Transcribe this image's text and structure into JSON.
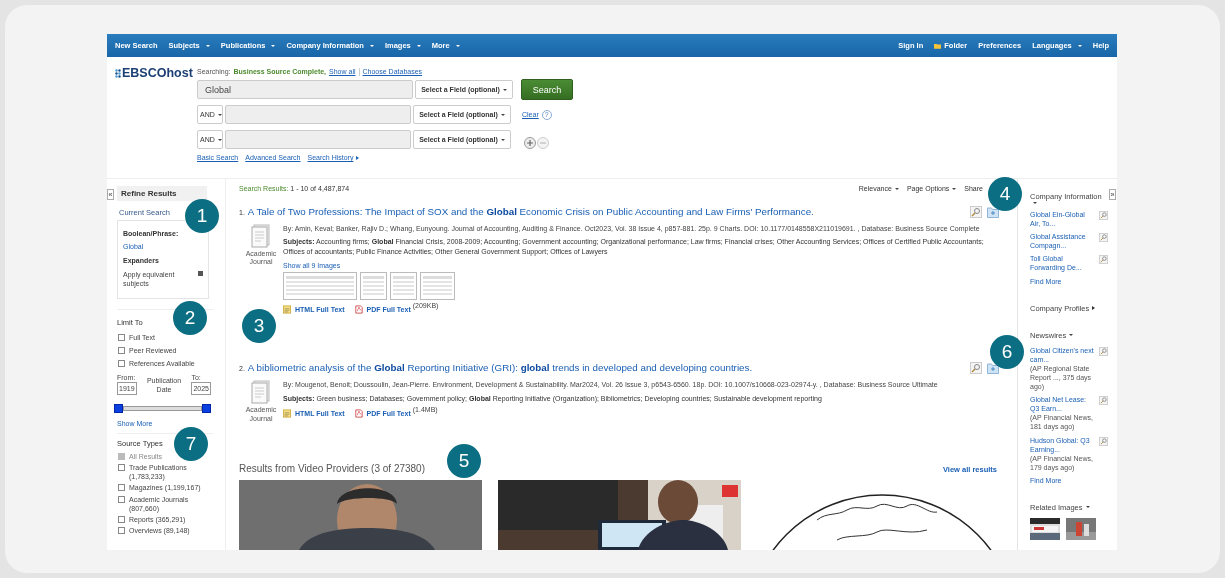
{
  "nav": {
    "left": [
      {
        "label": "New Search",
        "dropdown": false
      },
      {
        "label": "Subjects",
        "dropdown": true
      },
      {
        "label": "Publications",
        "dropdown": true
      },
      {
        "label": "Company Information",
        "dropdown": true
      },
      {
        "label": "Images",
        "dropdown": true
      },
      {
        "label": "More",
        "dropdown": true
      }
    ],
    "right": [
      {
        "label": "Sign In",
        "kind": "text"
      },
      {
        "label": "Folder",
        "kind": "folder"
      },
      {
        "label": "Preferences",
        "kind": "text"
      },
      {
        "label": "Languages",
        "kind": "dropdown"
      },
      {
        "label": "Help",
        "kind": "text"
      }
    ]
  },
  "search": {
    "logo": "EBSCOhost",
    "searching_label": "Searching:",
    "database": "Business Source Complete,",
    "show_all": "Show all",
    "choose_databases": "Choose Databases",
    "rows": [
      {
        "value": "Global",
        "field": "Select a Field (optional)"
      },
      {
        "operator": "AND",
        "field": "Select a Field (optional)"
      },
      {
        "operator": "AND",
        "field": "Select a Field (optional)"
      }
    ],
    "button": "Search",
    "clear": "Clear",
    "help": "?",
    "links": [
      {
        "label": "Basic Search",
        "kind": "link"
      },
      {
        "label": "Advanced Search",
        "kind": "link"
      },
      {
        "label": "Search History",
        "kind": "menu"
      }
    ]
  },
  "refine": {
    "collapse": "«",
    "title": "Refine Results",
    "current": {
      "title": "Current Search",
      "groups": [
        {
          "heading": "Boolean/Phrase:",
          "items": [
            {
              "kind": "link",
              "text": "Global"
            }
          ]
        },
        {
          "heading": "Expanders",
          "items": [
            {
              "kind": "removable",
              "text": "Apply equivalent subjects"
            }
          ]
        }
      ]
    },
    "limit": {
      "title": "Limit To",
      "options": [
        {
          "label": "Full Text",
          "checked": false
        },
        {
          "label": "Peer Reviewed",
          "checked": false
        },
        {
          "label": "References Available",
          "checked": false
        }
      ]
    },
    "date": {
      "from_label": "From:",
      "from": "1919",
      "label": "Publication Date",
      "to_label": "To:",
      "to": "2025",
      "level": 1
    },
    "show_more": "Show More",
    "source": {
      "title": "Source Types",
      "options": [
        {
          "label": "All Results",
          "checked": true,
          "disabled": true
        },
        {
          "label": "Trade Publications (1,783,233)",
          "checked": false,
          "disabled": false
        },
        {
          "label": "Magazines (1,199,167)",
          "checked": false,
          "disabled": false
        },
        {
          "label": "Academic Journals (807,660)",
          "checked": false,
          "disabled": false
        },
        {
          "label": "Reports (365,291)",
          "checked": false,
          "disabled": false
        },
        {
          "label": "Overviews (89,148)",
          "checked": false,
          "disabled": false
        }
      ]
    }
  },
  "results": {
    "summary_label": "Search Results:",
    "summary": "1 - 10 of 4,487,874",
    "tools": [
      {
        "label": "Relevance",
        "dropdown": true
      },
      {
        "label": "Page Options",
        "dropdown": true
      },
      {
        "label": "Share",
        "dropdown": false
      }
    ],
    "records": [
      {
        "number": "1.",
        "title": "A Tale of Two Professions: The Impact of SOX and the **Global** Economic Crisis on Public Accounting and Law Firms' Performance.",
        "type": "Academic Journal",
        "byline": "By: Amin, Keval; Banker, Rajiv D.; Whang, Eunyoung. Journal of Accounting, Auditing & Finance. Oct2023, Vol. 38 Issue 4, p857-881. 25p. 9 Charts. DOI: 10.1177/0148558X211019691. , Database: Business Source Complete",
        "subjects": "**Subjects:** Accounting firms; **Global** Financial Crisis, 2008-2009; Accounting; Government accounting; Organizational performance; Law firms; Financial crises; Other Accounting Services; Offices of Certified Public Accountants; Offices of accountants; Public Finance Activities; Other General Government Support; Offices of Lawyers",
        "images_link": "Show all 9 Images",
        "thumbnails": [
          {
            "kind": "picture"
          },
          {
            "kind": "picture"
          },
          {
            "kind": "picture"
          },
          {
            "kind": "picture"
          }
        ],
        "links": [
          {
            "kind": "html",
            "label": "HTML Full Text"
          },
          {
            "kind": "pdf",
            "label": "PDF Full Text",
            "size": "(209KB)"
          }
        ]
      },
      {
        "number": "2.",
        "title": "A bibliometric analysis of the **Global** Reporting Initiative (GRI): **global** trends in developed and developing countries.",
        "type": "Academic Journal",
        "byline": "By: Mougenot, Benoit; Doussoulin, Jean-Pierre. Environment, Development & Sustainability. Mar2024, Vol. 26 Issue 3, p6543-6560. 18p. DOI: 10.1007/s10668-023-02974-y. , Database: Business Source Ultimate",
        "subjects": "**Subjects:** Green business; Databases; Government policy; **Global** Reporting Initiative (Organization); Bibliometrics; Developing countries; Sustainable development reporting",
        "links": [
          {
            "kind": "html",
            "label": "HTML Full Text"
          },
          {
            "kind": "pdf",
            "label": "PDF Full Text",
            "size": "(1.4MB)"
          }
        ]
      }
    ],
    "video": {
      "title": "Results from Video Providers (3 of 27380)",
      "view_all": "View all results",
      "items": [
        {
          "kind": "picture"
        },
        {
          "kind": "picture"
        },
        {
          "kind": "picture"
        }
      ]
    }
  },
  "sidebar_right": {
    "expand": "»",
    "company": {
      "title": "Company Information",
      "items": [
        "Global Ein-Global Air, To...",
        "Global Assistance Compagn...",
        "Toll Global Forwarding De..."
      ],
      "find_more": "Find More"
    },
    "profiles": "Company Profiles",
    "newswires": {
      "title": "Newswires",
      "items": [
        {
          "headline": "Global Citizen's next cam...",
          "source": "(AP Regional State Report ..., 375 days ago)"
        },
        {
          "headline": "Global Net Lease: Q3 Earn...",
          "source": "(AP Financial News, 181 days ago)"
        },
        {
          "headline": "Hudson Global: Q3 Earning...",
          "source": "(AP Financial News, 179 days ago)"
        }
      ],
      "find_more": "Find More"
    },
    "related": {
      "title": "Related Images",
      "items": [
        {
          "kind": "picture"
        },
        {
          "kind": "picture"
        }
      ]
    }
  },
  "callouts": [
    "1",
    "2",
    "3",
    "4",
    "5",
    "6",
    "7"
  ]
}
